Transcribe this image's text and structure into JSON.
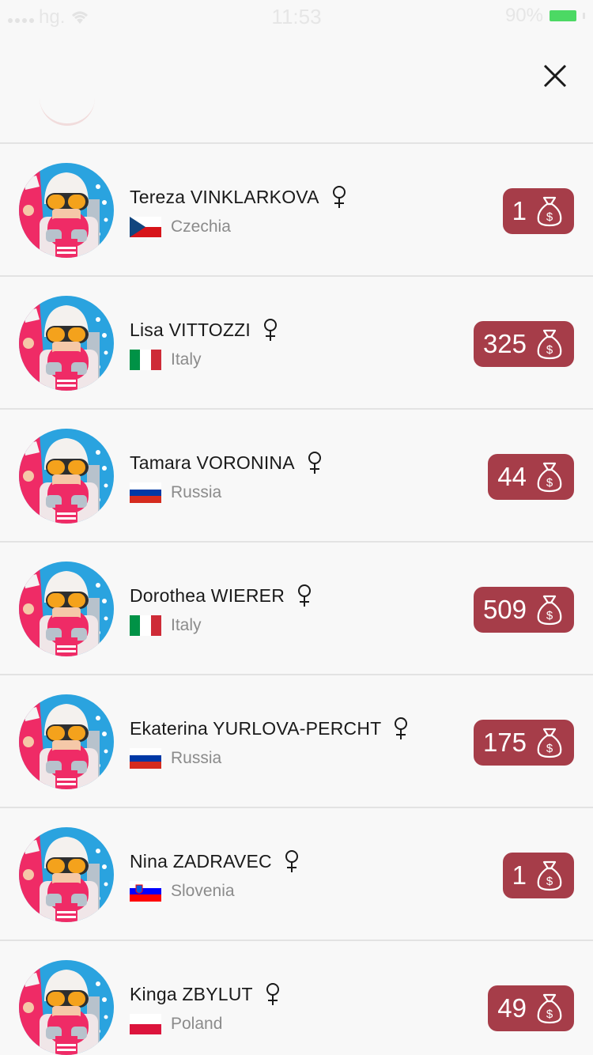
{
  "status_bar": {
    "carrier": "hg.",
    "time": "11:53",
    "battery": "90%"
  },
  "colors": {
    "badge": "#a63d49",
    "background": "#f8f8f8",
    "divider": "#e3e3e3",
    "battery": "#4cd964"
  },
  "icons": {
    "close": "close-icon",
    "gender": "female-symbol-icon",
    "points": "money-bag-dollar-icon"
  },
  "athletes": [
    {
      "name": "Tereza VINKLARKOVA",
      "country": "Czechia",
      "flag": "cz",
      "points": "1"
    },
    {
      "name": "Lisa VITTOZZI",
      "country": "Italy",
      "flag": "it",
      "points": "325"
    },
    {
      "name": "Tamara VORONINA",
      "country": "Russia",
      "flag": "ru",
      "points": "44"
    },
    {
      "name": "Dorothea WIERER",
      "country": "Italy",
      "flag": "it",
      "points": "509"
    },
    {
      "name": "Ekaterina YURLOVA-PERCHT",
      "country": "Russia",
      "flag": "ru",
      "points": "175"
    },
    {
      "name": "Nina ZADRAVEC",
      "country": "Slovenia",
      "flag": "si",
      "points": "1"
    },
    {
      "name": "Kinga ZBYLUT",
      "country": "Poland",
      "flag": "pl",
      "points": "49"
    }
  ]
}
